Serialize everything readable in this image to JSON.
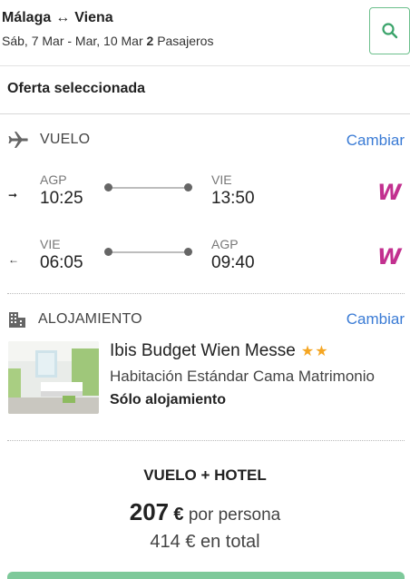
{
  "header": {
    "origin": "Málaga",
    "destination": "Viena",
    "dates": "Sáb, 7 Mar - Mar, 10 Mar",
    "passengers_count": "2",
    "passengers_label": "Pasajeros"
  },
  "offer": {
    "title": "Oferta seleccionada"
  },
  "flight": {
    "section_label": "VUELO",
    "change_label": "Cambiar",
    "legs": [
      {
        "direction": "outbound",
        "from_code": "AGP",
        "from_time": "10:25",
        "to_code": "VIE",
        "to_time": "13:50",
        "airline_logo": "W"
      },
      {
        "direction": "return",
        "from_code": "VIE",
        "from_time": "06:05",
        "to_code": "AGP",
        "to_time": "09:40",
        "airline_logo": "W"
      }
    ]
  },
  "hotel": {
    "section_label": "ALOJAMIENTO",
    "change_label": "Cambiar",
    "name": "Ibis Budget Wien Messe",
    "stars": 2,
    "room": "Habitación Estándar Cama Matrimonio",
    "board": "Sólo alojamiento"
  },
  "summary": {
    "package_label": "VUELO + HOTEL",
    "price_per_person": "207",
    "currency": "€",
    "per_person_label": "por persona",
    "total": "414",
    "total_label": "en total"
  },
  "colors": {
    "accent_green": "#7ec99a",
    "link_blue": "#3a7bd5",
    "star": "#f5a623",
    "airline": "#c2308f"
  },
  "icons": {
    "search": "search-icon",
    "flight": "airplane-icon",
    "hotel": "building-icon",
    "outbound": "arrow-right-icon",
    "return": "arrow-left-icon"
  }
}
